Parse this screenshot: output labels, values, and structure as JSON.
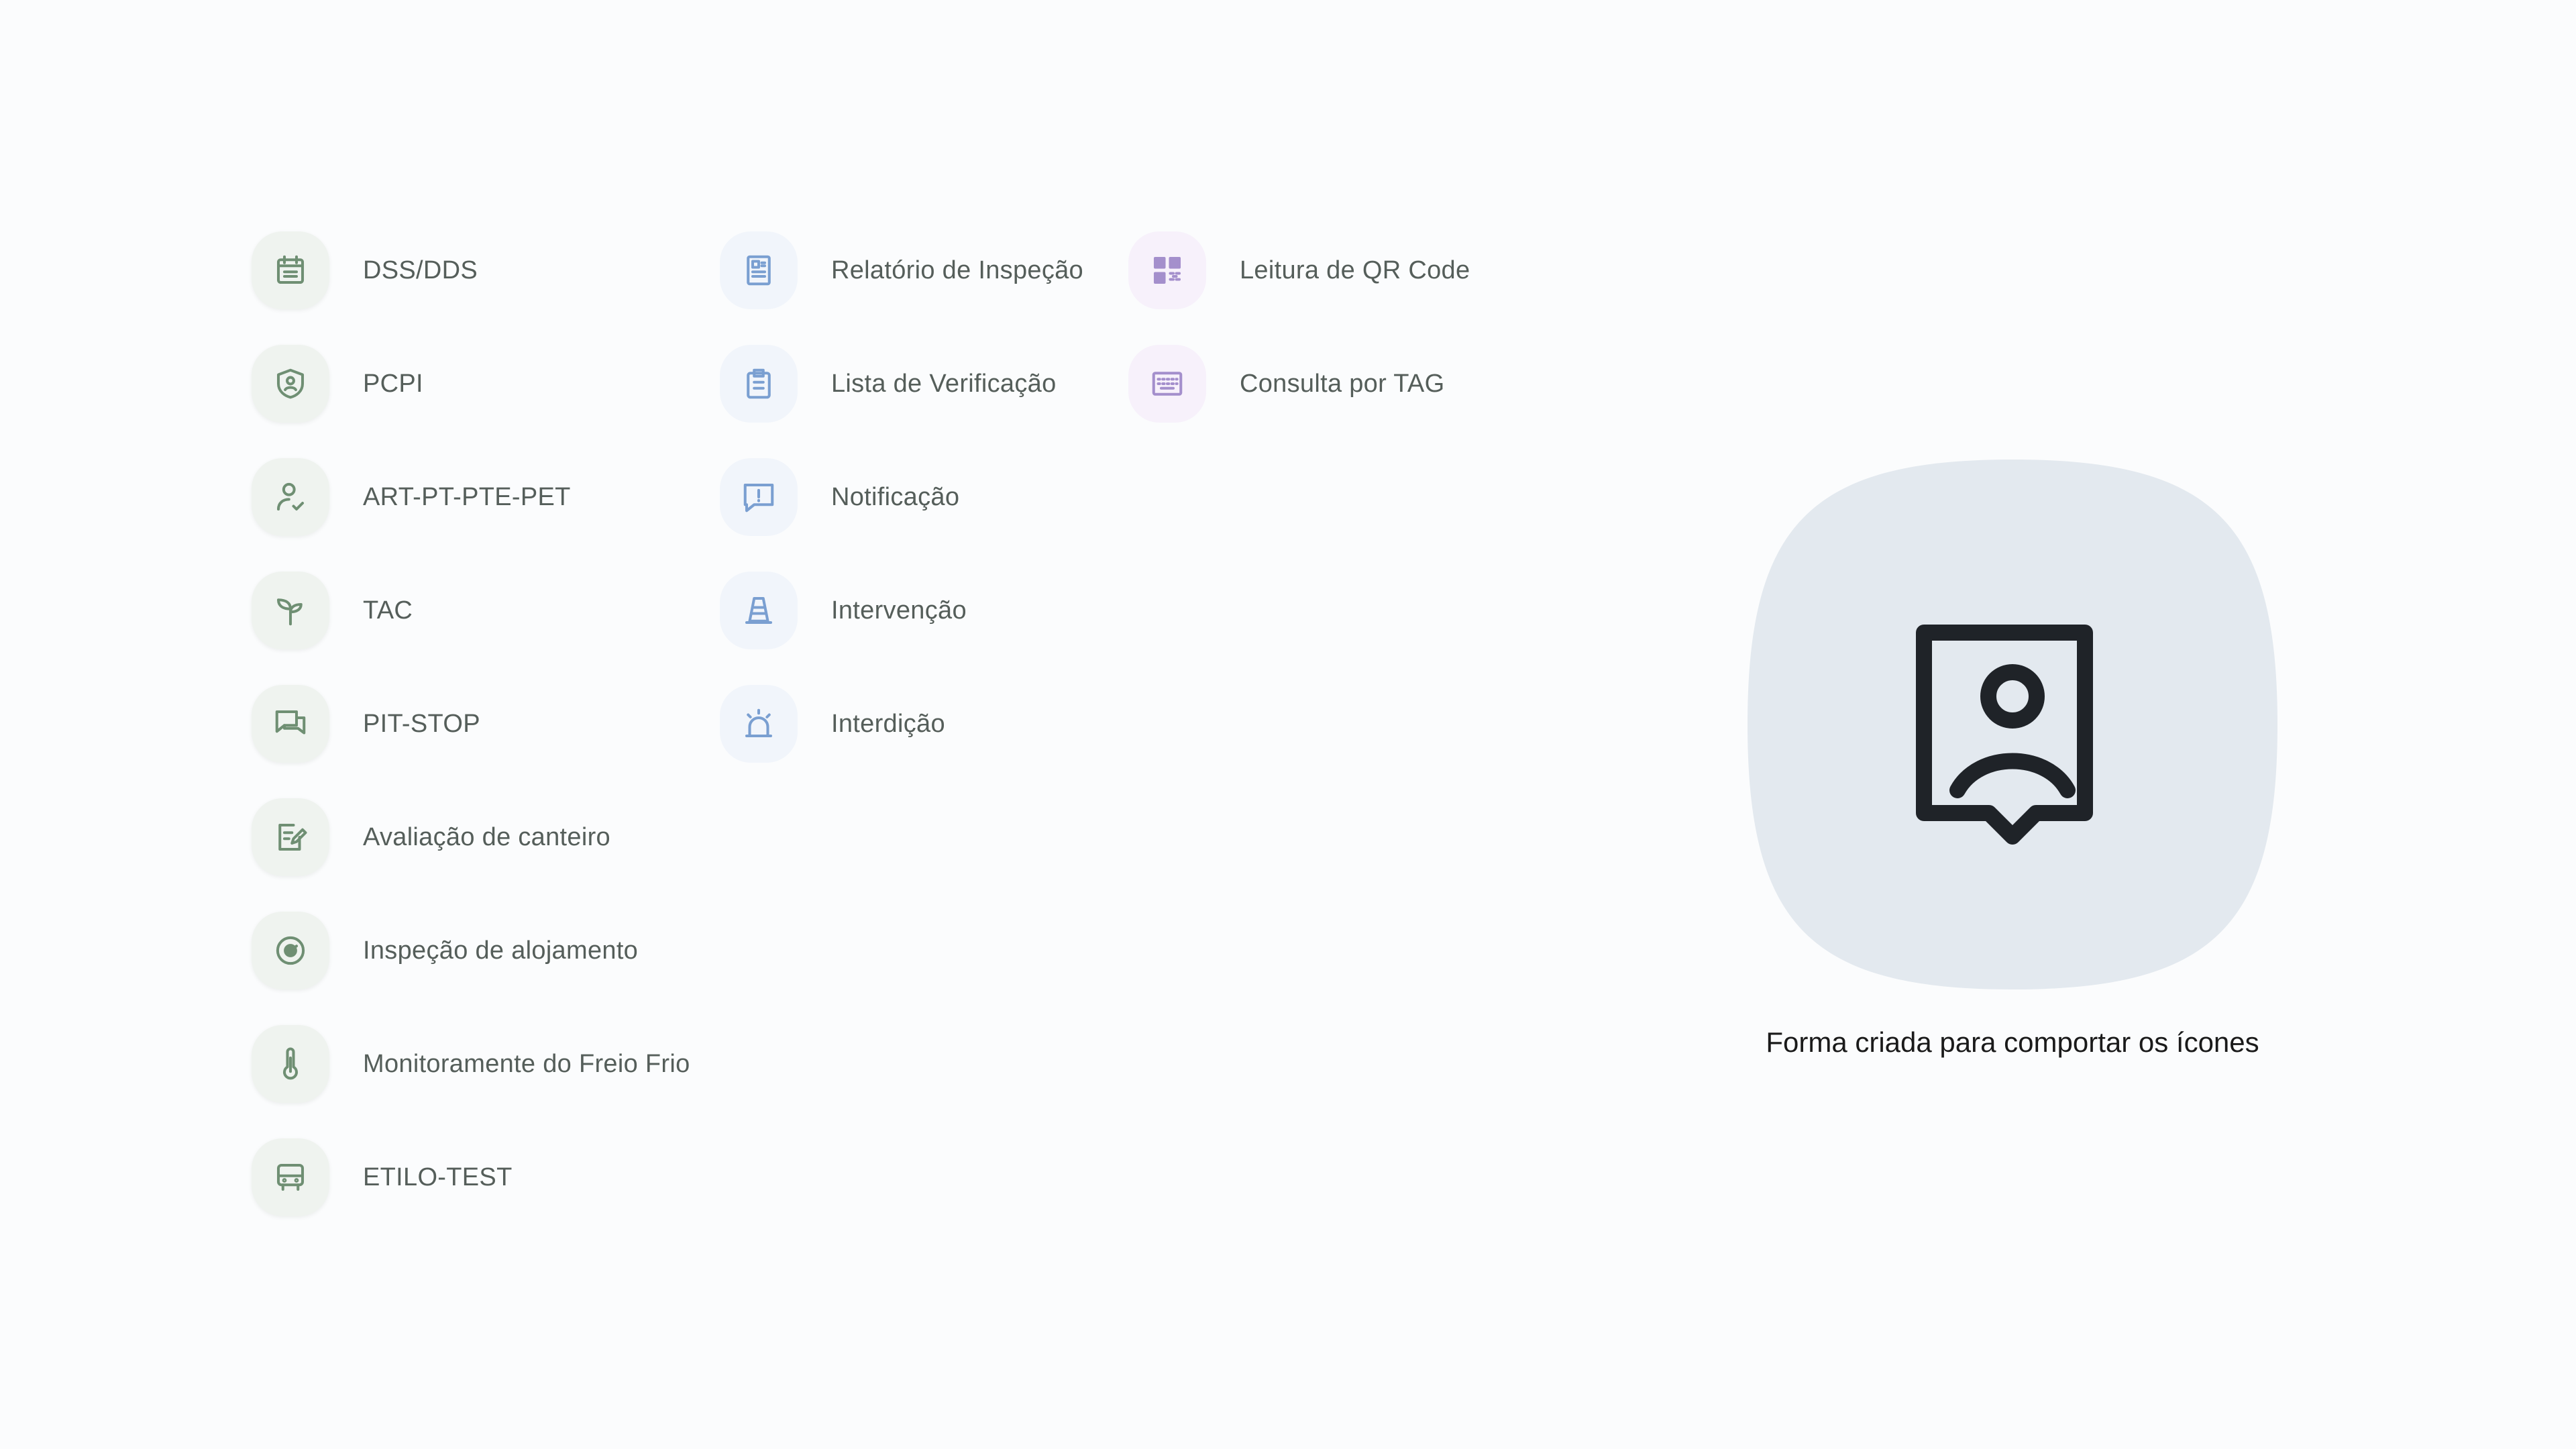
{
  "colors": {
    "background": "#fbfcfd",
    "green_icon": "#6f8f73",
    "blue_icon": "#7a9fd1",
    "purple_icon": "#a48fcc",
    "blob": "#e3e9ef",
    "blob_icon": "#1f2328"
  },
  "columns": [
    {
      "theme": "green",
      "items": [
        {
          "label": "DSS/DDS",
          "icon": "calendar-icon"
        },
        {
          "label": "PCPI",
          "icon": "shield-user-icon"
        },
        {
          "label": "ART-PT-PTE-PET",
          "icon": "user-check-icon"
        },
        {
          "label": "TAC",
          "icon": "sprout-icon"
        },
        {
          "label": "PIT-STOP",
          "icon": "chat-bubbles-icon"
        },
        {
          "label": "Avaliação de canteiro",
          "icon": "edit-note-icon"
        },
        {
          "label": "Inspeção de alojamento",
          "icon": "radar-icon"
        },
        {
          "label": "Monitoramente do Freio Frio",
          "icon": "thermometer-icon"
        },
        {
          "label": "ETILO-TEST",
          "icon": "bus-icon"
        }
      ]
    },
    {
      "theme": "blue",
      "items": [
        {
          "label": "Relatório de Inspeção",
          "icon": "report-icon"
        },
        {
          "label": "Lista de Verificação",
          "icon": "clipboard-list-icon"
        },
        {
          "label": "Notificação",
          "icon": "message-alert-icon"
        },
        {
          "label": "Intervenção",
          "icon": "traffic-cone-icon"
        },
        {
          "label": "Interdição",
          "icon": "siren-icon"
        }
      ]
    },
    {
      "theme": "purple",
      "items": [
        {
          "label": "Leitura de QR Code",
          "icon": "qr-code-icon"
        },
        {
          "label": "Consulta por TAG",
          "icon": "keyboard-icon"
        }
      ]
    }
  ],
  "illustration": {
    "icon": "user-tag-icon",
    "caption": "Forma criada para comportar os ícones"
  }
}
